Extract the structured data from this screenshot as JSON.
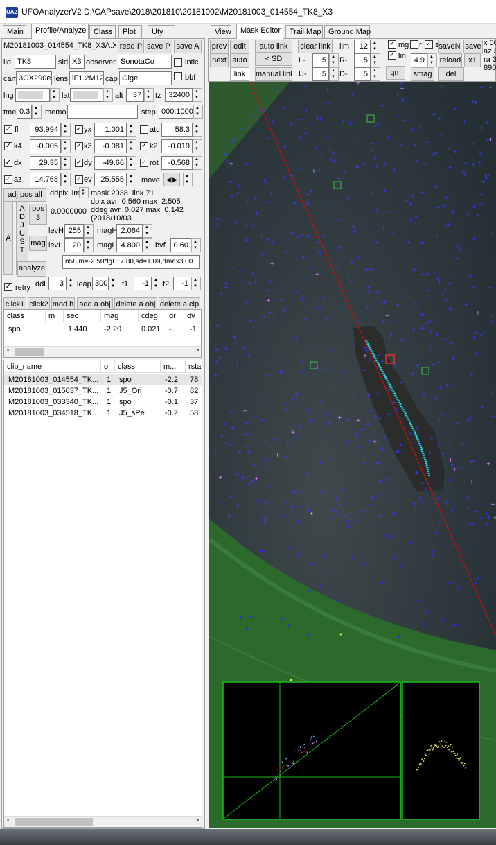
{
  "window": {
    "title": "UFOAnalyzerV2 D:\\CAPsave\\2018\\201810\\20181002\\M20181003_014554_TK8_X3",
    "icon_text": "UA2"
  },
  "left_tabs": [
    "Main",
    "Profile/Analyze",
    "Class",
    "Plot",
    "Uty"
  ],
  "right_tabs": [
    "View",
    "Mask Editor",
    "Trail Map",
    "Ground Map"
  ],
  "profile": {
    "filename": "M20181003_014554_TK8_X3A.XI",
    "read_p": "read P",
    "save_p": "save P",
    "save_a": "save A",
    "lid_label": "lid",
    "lid": "TK8",
    "sid_label": "sid",
    "sid": "X3",
    "observer_label": "observer",
    "observer": "SonotaCo",
    "intlc": "intlc",
    "cam_label": "cam",
    "cam": "3GX290e",
    "lens_label": "lens",
    "lens": "iF1.2M12",
    "cap_label": "cap",
    "cap": "Gige",
    "bbf": "bbf",
    "lng_label": "lng",
    "lat_label": "lat",
    "alt_label": "alt",
    "alt": "37",
    "tz_label": "tz",
    "tz": "32400",
    "tme_label": "tme",
    "tme": "0.3",
    "memo_label": "memo",
    "memo": "",
    "step_label": "step",
    "step": "000.1000"
  },
  "params": {
    "fl_label": "fl",
    "fl": "93.994",
    "yx_label": "yx",
    "yx": "1.001",
    "atc_label": "atc",
    "atc": "58.3",
    "k4_label": "k4",
    "k4": "-0.005",
    "k3_label": "k3",
    "k3": "-0.081",
    "k2_label": "k2",
    "k2": "-0.019",
    "dx_label": "dx",
    "dx": "29.35",
    "dy_label": "dy",
    "dy": "-49.66",
    "rot_label": "rot",
    "rot": "-0.568",
    "az_label": "az",
    "az": "14.768",
    "ev_label": "ev",
    "ev": "25.555",
    "move_label": "move"
  },
  "adjust": {
    "adj_pos_all": "adj pos all",
    "ddpix_lim": "ddpix lim",
    "pos3": "pos\n3",
    "value": "0.0000000",
    "stats": "mask 2038  link 71\ndpix avr  0.560 max  2.505\nddeg avr  0.027 max  0.142\n(2018/10/03",
    "a": "A",
    "adjust_vertical": "A\nD\nJ\nU\nS\nT",
    "mag": "mag",
    "levh_label": "levH",
    "levh": "255",
    "magh_label": "magH",
    "magh": "2.064",
    "levl_label": "levL",
    "levl": "20",
    "magl_label": "magL",
    "magl": "4.800",
    "bvf_label": "bvf",
    "bvf": "0.60",
    "analyze": "analyze",
    "formula": "n58,m=-2.50*lgL+7.80,sd=1.09,dmax3.00"
  },
  "retry": {
    "label": "retry",
    "ddl_label": "ddl",
    "ddl": "3",
    "leap_label": "leap",
    "leap": "300",
    "f1_label": "f1",
    "f1": "-1",
    "f2_label": "f2",
    "f2": "-1"
  },
  "actions": [
    "click1",
    "click2",
    "mod h",
    "add a obj",
    "delete a obj",
    "delete a cip"
  ],
  "obj_table": {
    "headers": [
      "class",
      "m",
      "sec",
      "mag",
      "cdeg",
      "dr",
      "dv"
    ],
    "rows": [
      [
        "spo",
        "",
        "1.440",
        "-2.20",
        "0.021",
        "-...",
        "-1"
      ]
    ]
  },
  "clip_table": {
    "headers": [
      "clip_name",
      "o",
      "class",
      "m...",
      "rsta"
    ],
    "rows": [
      [
        "M20181003_014554_TK...",
        "1",
        "spo",
        "-2.2",
        "78"
      ],
      [
        "M20181003_015037_TK...",
        "1",
        "J5_Ori",
        "-0.7",
        "82"
      ],
      [
        "M20181003_033340_TK...",
        "1",
        "spo",
        "-0.1",
        "37"
      ],
      [
        "M20181003_034518_TK...",
        "1",
        "J5_sPe",
        "-0.2",
        "58"
      ]
    ]
  },
  "mask": {
    "prev": "prev",
    "edit": "edit",
    "auto_link": "auto link",
    "clear_link": "clear link",
    "lim_label": "lim",
    "lim": "12",
    "next": "next",
    "auto": "auto",
    "sd": "< SD",
    "l_minus": "L-",
    "l_minus_val": "5",
    "r_minus": "R-",
    "r_minus_val": "5",
    "link": "link",
    "manual_link": "manual link",
    "u_minus": "U-",
    "u_minus_val": "5",
    "d_minus": "D-",
    "d_minus_val": "5",
    "mg": "mg",
    "r": "r",
    "s": "s",
    "saven": "saveN",
    "save": "save",
    "lin": "lin",
    "lin_val": "4.9",
    "reload": "reload",
    "x1": "x1",
    "qm": "qm",
    "smag": "smag",
    "del": "del",
    "side_info": "x 00\naz 3\nra 3\n890"
  }
}
